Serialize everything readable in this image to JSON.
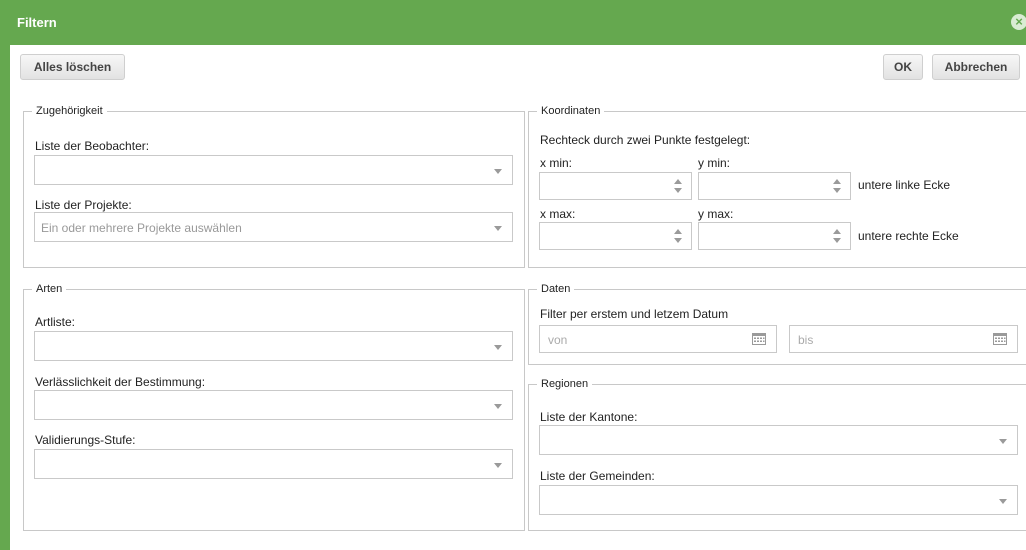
{
  "dialog": {
    "title": "Filtern"
  },
  "toolbar": {
    "clear_label": "Alles löschen",
    "ok_label": "OK",
    "cancel_label": "Abbrechen"
  },
  "zugehoerigkeit": {
    "legend": "Zugehörigkeit",
    "observers_label": "Liste der Beobachter:",
    "observers_value": "",
    "projects_label": "Liste der Projekte:",
    "projects_placeholder": "Ein oder mehrere Projekte auswählen"
  },
  "koordinaten": {
    "legend": "Koordinaten",
    "description": "Rechteck durch zwei Punkte festgelegt:",
    "xmin_label": "x min:",
    "ymin_label": "y min:",
    "lower_left_label": "untere linke Ecke",
    "xmax_label": "x max:",
    "ymax_label": "y max:",
    "lower_right_label": "untere rechte Ecke"
  },
  "arten": {
    "legend": "Arten",
    "species_label": "Artliste:",
    "reliability_label": "Verlässlichkeit der Bestimmung:",
    "validation_label": "Validierungs-Stufe:"
  },
  "daten": {
    "legend": "Daten",
    "description": "Filter per erstem und letzem Datum",
    "from_placeholder": "von",
    "to_placeholder": "bis"
  },
  "regionen": {
    "legend": "Regionen",
    "cantons_label": "Liste der Kantone:",
    "municipalities_label": "Liste der Gemeinden:"
  },
  "colors": {
    "accent": "#65a84f",
    "border": "#c8c8c8"
  },
  "icons": {
    "close": "close-circle-icon",
    "dropdown": "chevron-down-icon",
    "spinner": "spinner-arrows-icon",
    "calendar": "calendar-icon"
  }
}
